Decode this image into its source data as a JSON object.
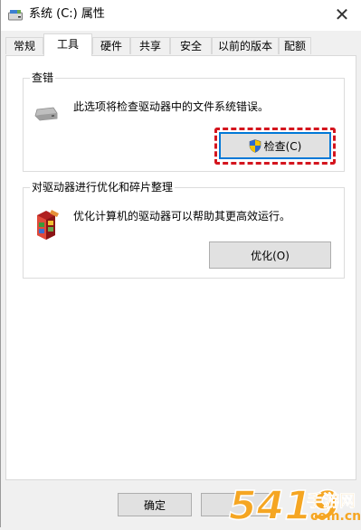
{
  "window": {
    "title": "系统 (C:) 属性",
    "close_icon": "close-icon"
  },
  "tabs": [
    {
      "label": "常规",
      "active": false
    },
    {
      "label": "工具",
      "active": true
    },
    {
      "label": "硬件",
      "active": false
    },
    {
      "label": "共享",
      "active": false
    },
    {
      "label": "安全",
      "active": false
    },
    {
      "label": "以前的版本",
      "active": false
    },
    {
      "label": "配额",
      "active": false
    }
  ],
  "error_check": {
    "title": "查错",
    "description": "此选项将检查驱动器中的文件系统错误。",
    "button_label": "检查(C)",
    "icon": "drive-icon",
    "button_icon": "uac-shield-icon",
    "highlight_color": "#d4151e"
  },
  "optimize": {
    "title": "对驱动器进行优化和碎片整理",
    "description": "优化计算机的驱动器可以帮助其更高效运行。",
    "button_label": "优化(O)",
    "icon": "defrag-icon"
  },
  "footer": {
    "ok_label": "确定"
  },
  "watermark": {
    "text_main": "手游网",
    "text_url": "com.cn",
    "number": "5419"
  }
}
